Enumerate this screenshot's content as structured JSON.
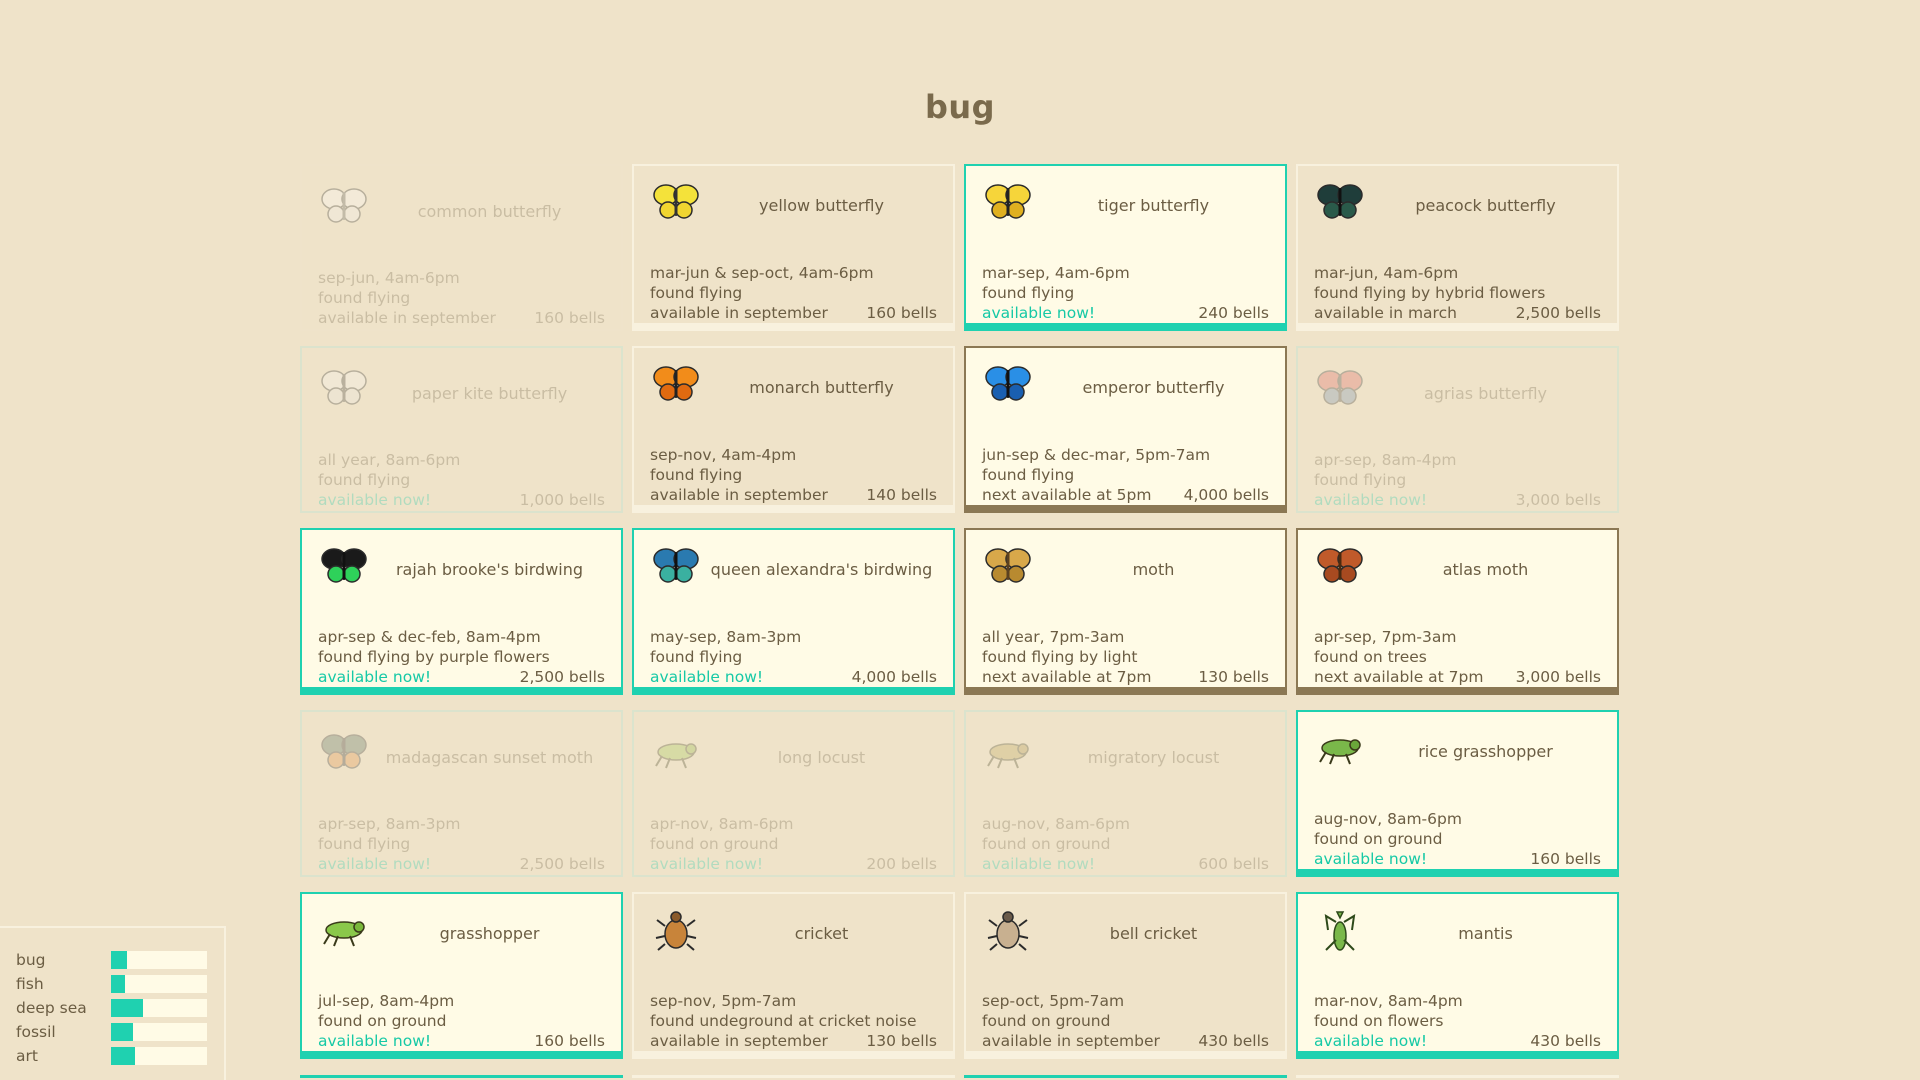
{
  "title": "bug",
  "colors": {
    "background": "#efe3c9",
    "available": "#1fd1b0",
    "next_available": "#8b7854",
    "card_bg": "#fffbe6"
  },
  "cards": [
    {
      "name": "common butterfly",
      "icon": "common-butterfly-icon",
      "line1": "sep-jun, 4am-6pm",
      "line2": "found flying",
      "status": "available in september",
      "bells": "160 bells",
      "state": "faded",
      "status_now": false
    },
    {
      "name": "yellow butterfly",
      "icon": "yellow-butterfly-icon",
      "line1": "mar-jun & sep-oct, 4am-6pm",
      "line2": "found flying",
      "status": "available in september",
      "bells": "160 bells",
      "state": "plain",
      "status_now": false
    },
    {
      "name": "tiger butterfly",
      "icon": "tiger-butterfly-icon",
      "line1": "mar-sep, 4am-6pm",
      "line2": "found flying",
      "status": "available now!",
      "bells": "240 bells",
      "state": "avail",
      "status_now": true
    },
    {
      "name": "peacock butterfly",
      "icon": "peacock-butterfly-icon",
      "line1": "mar-jun, 4am-6pm",
      "line2": "found flying by hybrid flowers",
      "status": "available in march",
      "bells": "2,500 bells",
      "state": "plain",
      "status_now": false
    },
    {
      "name": "paper kite butterfly",
      "icon": "paper-kite-butterfly-icon",
      "line1": "all year, 8am-6pm",
      "line2": "found flying",
      "status": "available now!",
      "bells": "1,000 bells",
      "state": "faded-avail",
      "status_now": true
    },
    {
      "name": "monarch butterfly",
      "icon": "monarch-butterfly-icon",
      "line1": "sep-nov, 4am-4pm",
      "line2": "found flying",
      "status": "available in september",
      "bells": "140 bells",
      "state": "plain",
      "status_now": false
    },
    {
      "name": "emperor butterfly",
      "icon": "emperor-butterfly-icon",
      "line1": "jun-sep & dec-mar, 5pm-7am",
      "line2": "found flying",
      "status": "next available at 5pm",
      "bells": "4,000 bells",
      "state": "next",
      "status_now": false
    },
    {
      "name": "agrias butterfly",
      "icon": "agrias-butterfly-icon",
      "line1": "apr-sep, 8am-4pm",
      "line2": "found flying",
      "status": "available now!",
      "bells": "3,000 bells",
      "state": "faded-avail",
      "status_now": true
    },
    {
      "name": "rajah brooke's birdwing",
      "icon": "rajah-brookes-birdwing-icon",
      "line1": "apr-sep & dec-feb, 8am-4pm",
      "line2": "found flying by purple flowers",
      "status": "available now!",
      "bells": "2,500 bells",
      "state": "avail",
      "status_now": true
    },
    {
      "name": "queen alexandra's birdwing",
      "icon": "queen-alexandras-birdwing-icon",
      "line1": "may-sep, 8am-3pm",
      "line2": "found flying",
      "status": "available now!",
      "bells": "4,000 bells",
      "state": "avail",
      "status_now": true
    },
    {
      "name": "moth",
      "icon": "moth-icon",
      "line1": "all year, 7pm-3am",
      "line2": "found flying by light",
      "status": "next available at 7pm",
      "bells": "130 bells",
      "state": "next",
      "status_now": false
    },
    {
      "name": "atlas moth",
      "icon": "atlas-moth-icon",
      "line1": "apr-sep, 7pm-3am",
      "line2": "found on trees",
      "status": "next available at 7pm",
      "bells": "3,000 bells",
      "state": "next",
      "status_now": false
    },
    {
      "name": "madagascan sunset moth",
      "icon": "madagascan-sunset-moth-icon",
      "line1": "apr-sep, 8am-3pm",
      "line2": "found flying",
      "status": "available now!",
      "bells": "2,500 bells",
      "state": "faded-avail",
      "status_now": true
    },
    {
      "name": "long locust",
      "icon": "long-locust-icon",
      "line1": "apr-nov, 8am-6pm",
      "line2": "found on ground",
      "status": "available now!",
      "bells": "200 bells",
      "state": "faded-avail",
      "status_now": true
    },
    {
      "name": "migratory locust",
      "icon": "migratory-locust-icon",
      "line1": "aug-nov, 8am-6pm",
      "line2": "found on ground",
      "status": "available now!",
      "bells": "600 bells",
      "state": "faded-avail",
      "status_now": true
    },
    {
      "name": "rice grasshopper",
      "icon": "rice-grasshopper-icon",
      "line1": "aug-nov, 8am-6pm",
      "line2": "found on ground",
      "status": "available now!",
      "bells": "160 bells",
      "state": "avail",
      "status_now": true
    },
    {
      "name": "grasshopper",
      "icon": "grasshopper-icon",
      "line1": "jul-sep, 8am-4pm",
      "line2": "found on ground",
      "status": "available now!",
      "bells": "160 bells",
      "state": "avail",
      "status_now": true
    },
    {
      "name": "cricket",
      "icon": "cricket-icon",
      "line1": "sep-nov, 5pm-7am",
      "line2": "found undeground at cricket noise",
      "status": "available in september",
      "bells": "130 bells",
      "state": "plain",
      "status_now": false
    },
    {
      "name": "bell cricket",
      "icon": "bell-cricket-icon",
      "line1": "sep-oct, 5pm-7am",
      "line2": "found on ground",
      "status": "available in september",
      "bells": "430 bells",
      "state": "plain",
      "status_now": false
    },
    {
      "name": "mantis",
      "icon": "mantis-icon",
      "line1": "mar-nov, 8am-4pm",
      "line2": "found on flowers",
      "status": "available now!",
      "bells": "430 bells",
      "state": "avail",
      "status_now": true
    }
  ],
  "progress": [
    {
      "label": "bug",
      "fraction": 0.17
    },
    {
      "label": "fish",
      "fraction": 0.15
    },
    {
      "label": "deep sea",
      "fraction": 0.33
    },
    {
      "label": "fossil",
      "fraction": 0.23
    },
    {
      "label": "art",
      "fraction": 0.25
    }
  ],
  "next_row_states": [
    "avail",
    "plain",
    "avail",
    "plain"
  ]
}
